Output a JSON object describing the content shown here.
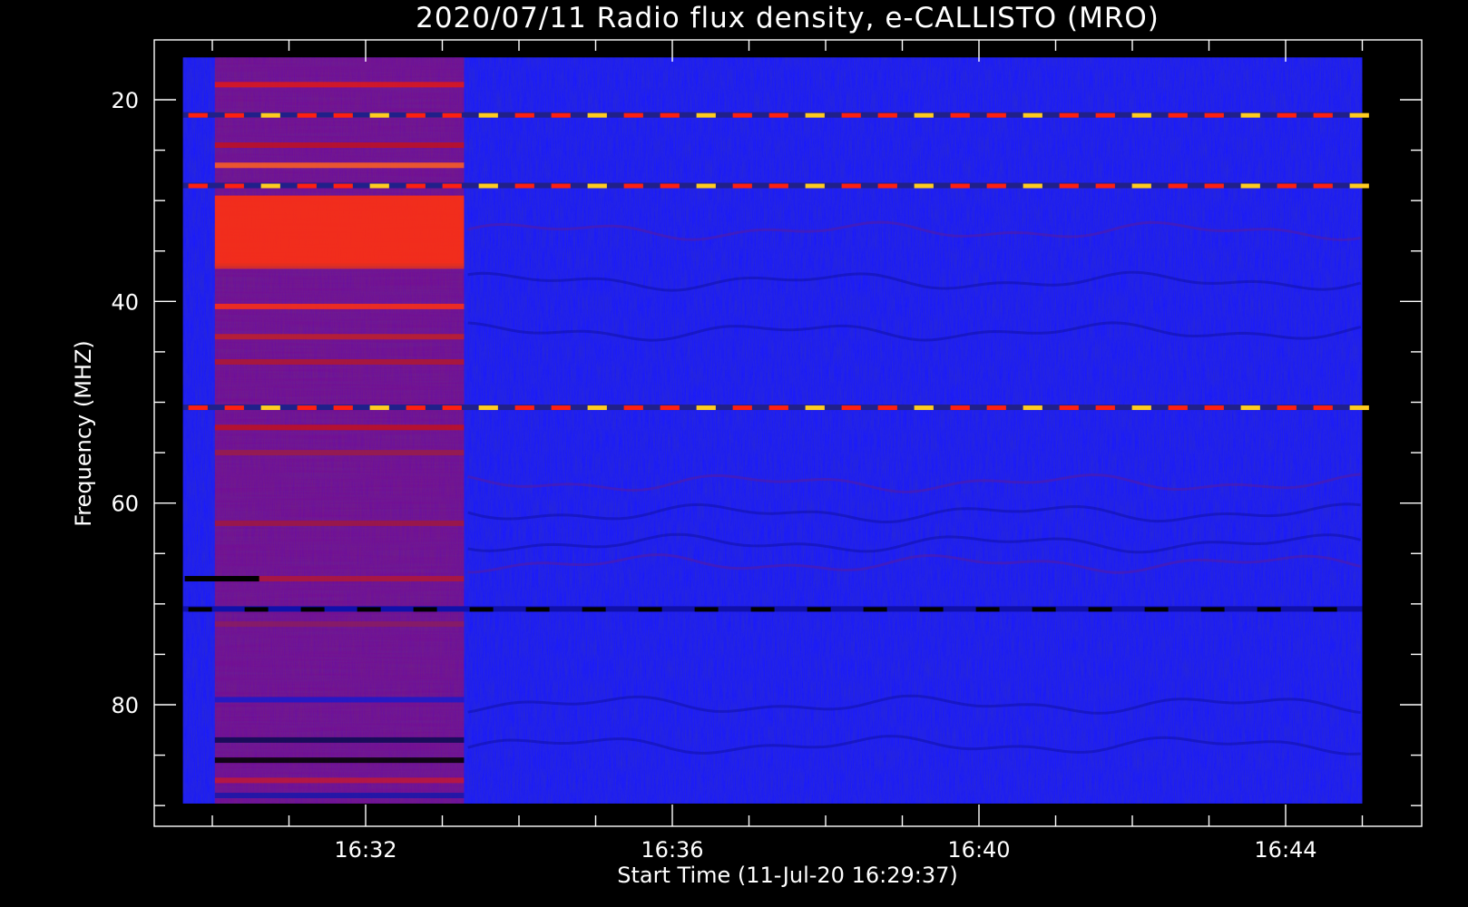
{
  "chart_data": {
    "type": "heatmap",
    "title": "2020/07/11  Radio flux density, e-CALLISTO (MRO)",
    "xlabel": "Start Time (11-Jul-20 16:29:37)",
    "ylabel": "Frequency (MHZ)",
    "x_start": "16:29:37",
    "x_end": "16:45:00",
    "x_ticks": [
      {
        "value": "16:32",
        "label": "16:32"
      },
      {
        "value": "16:36",
        "label": "16:36"
      },
      {
        "value": "16:40",
        "label": "16:40"
      },
      {
        "value": "16:44",
        "label": "16:44"
      }
    ],
    "x_minor_ticks": [
      "16:30",
      "16:31",
      "16:33",
      "16:34",
      "16:35",
      "16:37",
      "16:38",
      "16:39",
      "16:41",
      "16:42",
      "16:43",
      "16:45"
    ],
    "ylim": [
      90,
      15
    ],
    "y_ticks": [
      20,
      40,
      60,
      80
    ],
    "y_minor_ticks": [
      25,
      30,
      35,
      45,
      50,
      55,
      65,
      70,
      75,
      85,
      90
    ],
    "y_inverted": true,
    "data_extent": {
      "t_start": "16:29:37",
      "t_end": "16:45:00",
      "f_min": 89.8,
      "f_max": 15.8
    },
    "colormap": [
      "#000000",
      "#0000ff",
      "#ff0000",
      "#ffff00"
    ],
    "background_level_color": "#1a1aff",
    "events": [
      {
        "kind": "broadband_enhancement",
        "t_start": "16:30:02",
        "t_end": "16:33:17",
        "f_min": 15.8,
        "f_max": 89.8,
        "color": "#cc1028"
      },
      {
        "kind": "intense_band",
        "t_start": "16:30:02",
        "t_end": "16:33:17",
        "f_min": 29.5,
        "f_max": 36.5,
        "color": "#ff3010"
      }
    ],
    "interference_lines_mhz": [
      21.5,
      28.5,
      50.5,
      70.5
    ]
  }
}
